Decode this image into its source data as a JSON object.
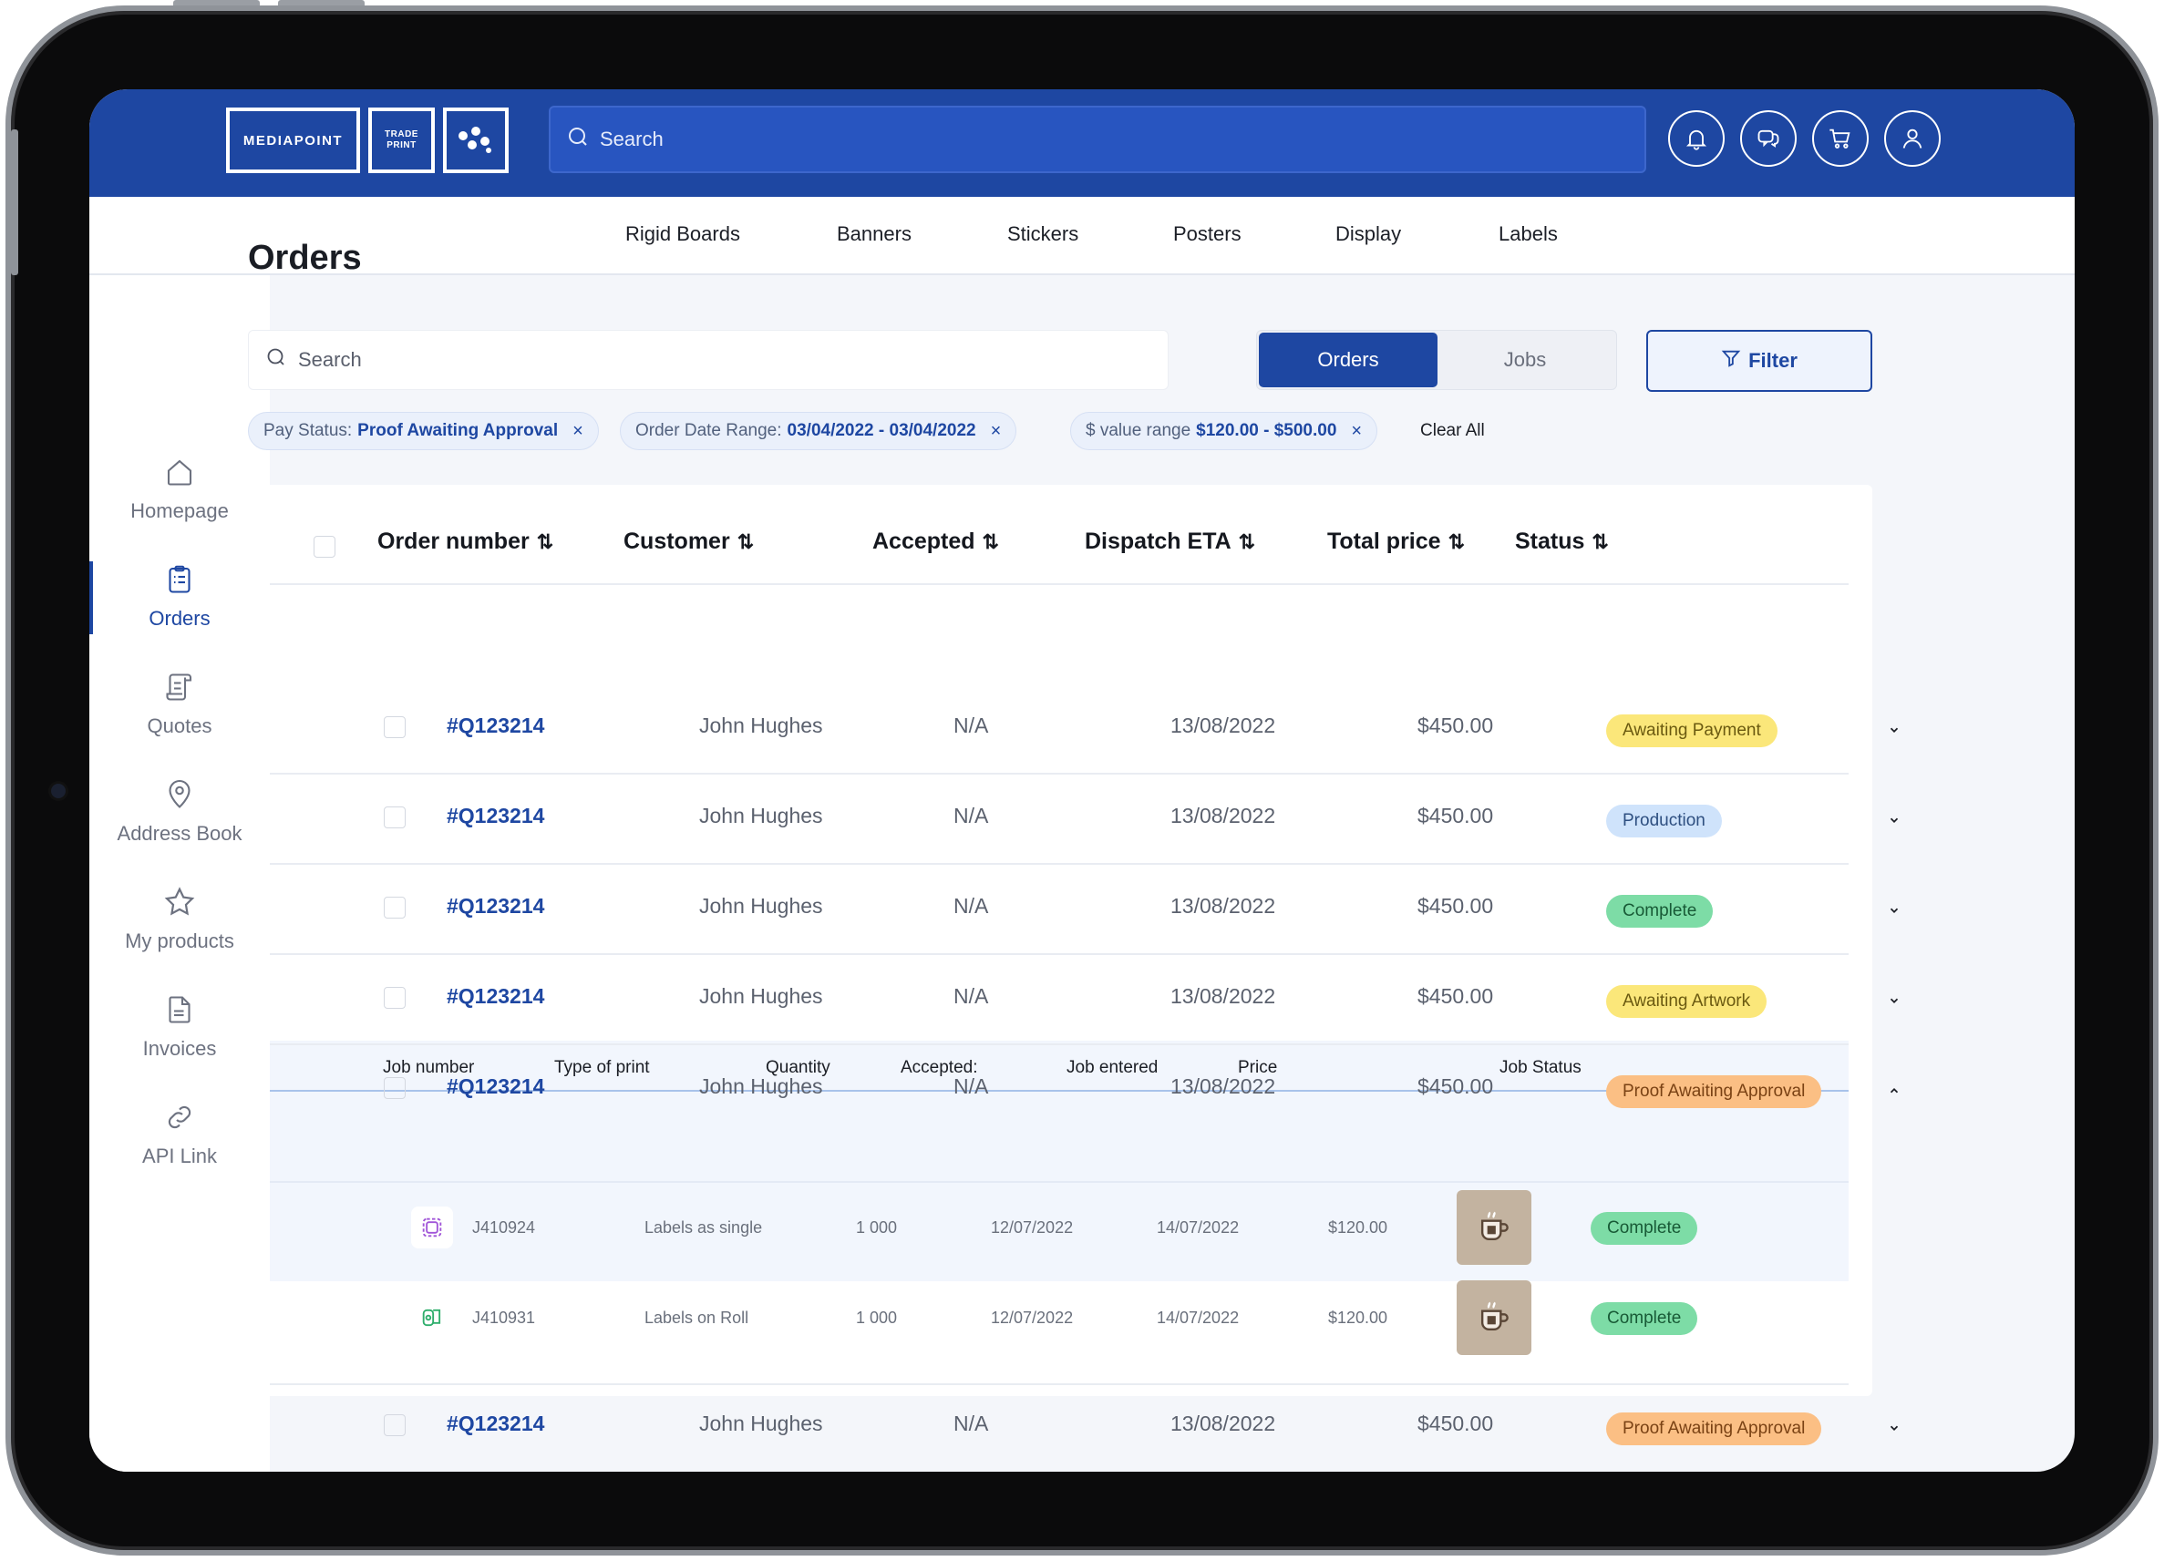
{
  "brand": {
    "main": "MEDIAPOINT",
    "trade_line1": "TRADE",
    "trade_line2": "PRINT"
  },
  "header": {
    "search_placeholder": "Search",
    "icons": [
      "bell-icon",
      "chat-icon",
      "cart-icon",
      "user-icon"
    ]
  },
  "categories": [
    "Rigid Boards",
    "Banners",
    "Stickers",
    "Posters",
    "Display",
    "Labels"
  ],
  "sidebar": {
    "items": [
      {
        "label": "Homepage",
        "icon": "home-icon"
      },
      {
        "label": "Orders",
        "icon": "clipboard-icon"
      },
      {
        "label": "Quotes",
        "icon": "scroll-icon"
      },
      {
        "label": "Address Book",
        "icon": "location-pin-icon"
      },
      {
        "label": "My products",
        "icon": "star-icon"
      },
      {
        "label": "Invoices",
        "icon": "document-icon"
      },
      {
        "label": "API Link",
        "icon": "link-icon"
      }
    ],
    "active": "Orders"
  },
  "main": {
    "title": "Orders",
    "search_placeholder": "Search",
    "toggle": {
      "active": "Orders",
      "inactive": "Jobs"
    },
    "filter_label": "Filter",
    "chips": [
      {
        "key": "Pay Status:",
        "value": "Proof Awaiting Approval",
        "close": "×"
      },
      {
        "key": "Order Date Range:",
        "value": "03/04/2022 - 03/04/2022",
        "close": "×"
      },
      {
        "key": "$ value range",
        "value": "$120.00 - $500.00",
        "close": "×"
      }
    ],
    "clear_all": "Clear All"
  },
  "table": {
    "sort_glyph": "⇅",
    "columns": [
      "Order number",
      "Customer",
      "Accepted",
      "Dispatch ETA",
      "Total price",
      "Status"
    ],
    "rows": [
      {
        "order": "#Q123214",
        "customer": "John Hughes",
        "accepted": "N/A",
        "eta": "13/08/2022",
        "price": "$450.00",
        "status": "Awaiting Payment",
        "expanded": false
      },
      {
        "order": "#Q123214",
        "customer": "John Hughes",
        "accepted": "N/A",
        "eta": "13/08/2022",
        "price": "$450.00",
        "status": "Production",
        "expanded": false
      },
      {
        "order": "#Q123214",
        "customer": "John Hughes",
        "accepted": "N/A",
        "eta": "13/08/2022",
        "price": "$450.00",
        "status": "Complete",
        "expanded": false
      },
      {
        "order": "#Q123214",
        "customer": "John Hughes",
        "accepted": "N/A",
        "eta": "13/08/2022",
        "price": "$450.00",
        "status": "Awaiting Artwork",
        "expanded": false
      },
      {
        "order": "#Q123214",
        "customer": "John Hughes",
        "accepted": "N/A",
        "eta": "13/08/2022",
        "price": "$450.00",
        "status": "Proof Awaiting Approval",
        "expanded": true
      },
      {
        "order": "#Q123214",
        "customer": "John Hughes",
        "accepted": "N/A",
        "eta": "13/08/2022",
        "price": "$450.00",
        "status": "Proof Awaiting Approval",
        "expanded": false
      }
    ],
    "status_colors": {
      "Awaiting Payment": {
        "bg": "#fbe77a",
        "fg": "#6b5a10"
      },
      "Production": {
        "bg": "#cfe3fb",
        "fg": "#2e4f80"
      },
      "Complete": {
        "bg": "#7ddca6",
        "fg": "#185a36"
      },
      "Awaiting Artwork": {
        "bg": "#fbe77a",
        "fg": "#6b5a10"
      },
      "Proof Awaiting Approval": {
        "bg": "#fbbf84",
        "fg": "#7a4214"
      }
    }
  },
  "jobs": {
    "columns": [
      "Job number",
      "Type of print",
      "Quantity",
      "Accepted:",
      "Job entered",
      "Price",
      "Job Status"
    ],
    "rows": [
      {
        "icon": "label-single-icon",
        "number": "J410924",
        "type": "Labels as single",
        "quantity": "1 000",
        "accepted": "12/07/2022",
        "entered": "14/07/2022",
        "price": "$120.00",
        "thumbnail": "coffee-cup-thumbnail",
        "status": "Complete"
      },
      {
        "icon": "label-roll-icon",
        "number": "J410931",
        "type": "Labels on Roll",
        "quantity": "1 000",
        "accepted": "12/07/2022",
        "entered": "14/07/2022",
        "price": "$120.00",
        "thumbnail": "coffee-cup-thumbnail",
        "status": "Complete"
      }
    ]
  },
  "colors": {
    "brand": "#1e47a2",
    "page_bg": "#f4f6fa"
  }
}
